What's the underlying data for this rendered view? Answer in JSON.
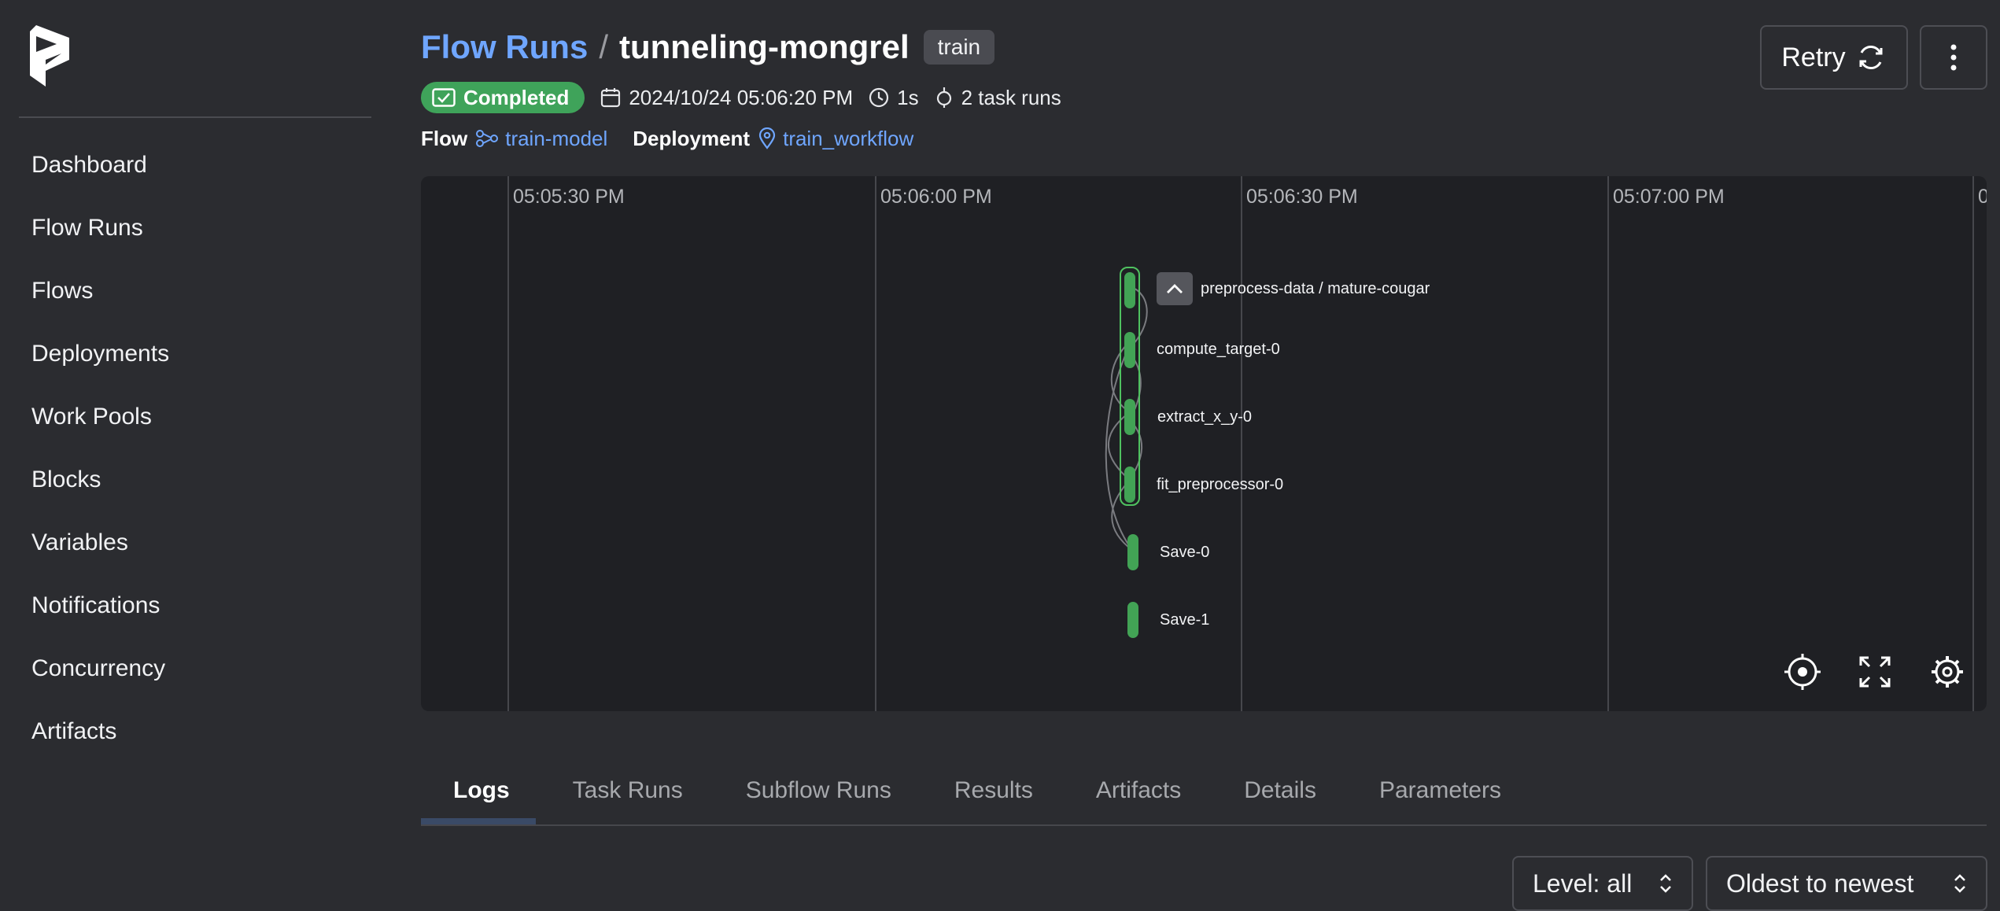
{
  "sidebar": {
    "items": [
      {
        "label": "Dashboard"
      },
      {
        "label": "Flow Runs"
      },
      {
        "label": "Flows"
      },
      {
        "label": "Deployments"
      },
      {
        "label": "Work Pools"
      },
      {
        "label": "Blocks"
      },
      {
        "label": "Variables"
      },
      {
        "label": "Notifications"
      },
      {
        "label": "Concurrency"
      },
      {
        "label": "Artifacts"
      }
    ]
  },
  "header": {
    "breadcrumb_link": "Flow Runs",
    "separator": "/",
    "run_name": "tunneling-mongrel",
    "tag": "train",
    "status": "Completed",
    "start_time": "2024/10/24 05:06:20 PM",
    "duration": "1s",
    "task_runs": "2 task runs",
    "flow_key": "Flow",
    "flow_value": "train-model",
    "deployment_key": "Deployment",
    "deployment_value": "train_workflow",
    "retry_label": "Retry"
  },
  "timeline": {
    "ticks": [
      "05:05:30 PM",
      "05:06:00 PM",
      "05:06:30 PM",
      "05:07:00 PM",
      "0"
    ],
    "nodes": [
      {
        "label": "preprocess-data / mature-cougar"
      },
      {
        "label": "compute_target-0"
      },
      {
        "label": "extract_x_y-0"
      },
      {
        "label": "fit_preprocessor-0"
      },
      {
        "label": "Save-0"
      },
      {
        "label": "Save-1"
      }
    ]
  },
  "tabs": [
    {
      "label": "Logs",
      "active": true
    },
    {
      "label": "Task Runs"
    },
    {
      "label": "Subflow Runs"
    },
    {
      "label": "Results"
    },
    {
      "label": "Artifacts"
    },
    {
      "label": "Details"
    },
    {
      "label": "Parameters"
    }
  ],
  "logs": {
    "level_select": "Level: all",
    "order_select": "Oldest to newest"
  },
  "colors": {
    "accent_link": "#6fa6ff",
    "status_completed": "#3fa35a",
    "background": "#2b2c30",
    "timeline_bg": "#1f2024"
  }
}
